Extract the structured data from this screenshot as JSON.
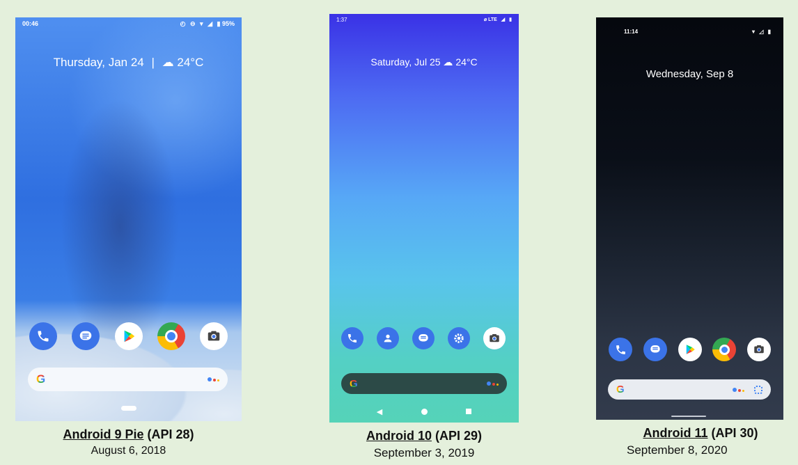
{
  "phones": [
    {
      "status_time": "00:46",
      "status_right": "95%",
      "date_text": "Thursday, Jan 24",
      "separator": "|",
      "weather": "24°C",
      "dock_icons": [
        "phone-icon",
        "messages-icon",
        "play-store-icon",
        "chrome-icon",
        "camera-icon"
      ],
      "search_logo": "G",
      "caption_link": "Android 9 Pie",
      "caption_api": "(API 28)",
      "caption_date": "August 6, 2018"
    },
    {
      "status_time": "1:37",
      "status_right": "LTE",
      "date_text": "Saturday, Jul 25",
      "weather": "24°C",
      "dock_icons": [
        "phone-icon",
        "contacts-icon",
        "messages-icon",
        "settings-icon",
        "camera-icon"
      ],
      "search_logo": "G",
      "caption_link": "Android 10",
      "caption_api": "(API 29)",
      "caption_date": "September 3, 2019"
    },
    {
      "status_time": "11:14",
      "date_text": "Wednesday, Sep 8",
      "dock_icons": [
        "phone-icon",
        "messages-icon",
        "play-store-icon",
        "chrome-icon",
        "camera-icon"
      ],
      "search_logo": "G",
      "caption_link": "Android 11",
      "caption_api": "(API 30)",
      "caption_date": "September 8, 2020"
    }
  ],
  "colors": {
    "background": "#e4f0dc",
    "icon_blue": "#3b73e8",
    "android10_search": "#2c4a47"
  }
}
